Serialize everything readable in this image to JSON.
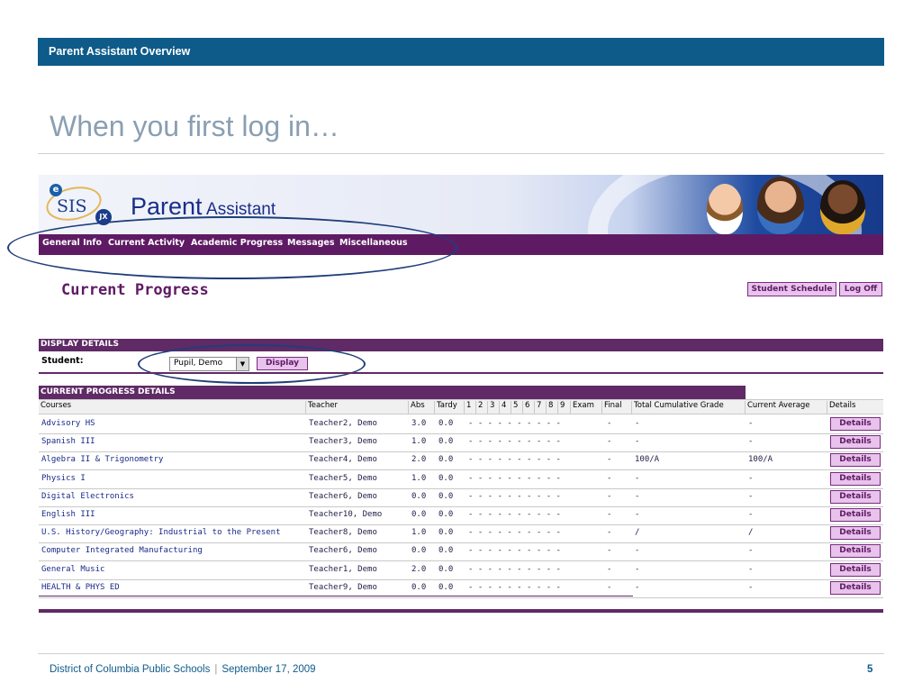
{
  "slide": {
    "header": "Parent Assistant Overview",
    "title": "When you first log in…",
    "footer_org": "District of Columbia Public Schools",
    "footer_separator": "|",
    "footer_date": "September 17, 2009",
    "page_number": "5"
  },
  "app": {
    "logo_e": "e",
    "logo_text": "SIS",
    "logo_badge": "JX",
    "title_main": "Parent",
    "title_sub": "Assistant",
    "nav": [
      "General Info",
      "Current Activity",
      "Academic Progress",
      "Messages",
      "Miscellaneous"
    ],
    "page_heading": "Current Progress",
    "student_schedule_label": "Student Schedule",
    "logoff_label": "Log Off",
    "display_details_label": "DISPLAY DETAILS",
    "student_label": "Student:",
    "student_value": "Pupil, Demo",
    "display_button": "Display",
    "progress_details_label": "CURRENT PROGRESS DETAILS"
  },
  "table": {
    "headers": [
      "Courses",
      "Teacher",
      "Abs",
      "Tardy",
      "1",
      "2",
      "3",
      "4",
      "5",
      "6",
      "7",
      "8",
      "9",
      "Exam",
      "Final",
      "Total Cumulative Grade",
      "Current Average",
      "Details"
    ],
    "rows": [
      {
        "course": "Advisory HS",
        "teacher": "Teacher2, Demo",
        "abs": "3.0",
        "tardy": "0.0",
        "periods": "- - - - - - - - - -",
        "final": "-",
        "total": "-",
        "avg": "-",
        "details": "Details"
      },
      {
        "course": "Spanish III",
        "teacher": "Teacher3, Demo",
        "abs": "1.0",
        "tardy": "0.0",
        "periods": "- - - - - - - - - -",
        "final": "-",
        "total": "-",
        "avg": "-",
        "details": "Details"
      },
      {
        "course": "Algebra II & Trigonometry",
        "teacher": "Teacher4, Demo",
        "abs": "2.0",
        "tardy": "0.0",
        "periods": "- - - - - - - - - -",
        "final": "-",
        "total": "100/A",
        "avg": "100/A",
        "details": "Details"
      },
      {
        "course": "Physics I",
        "teacher": "Teacher5, Demo",
        "abs": "1.0",
        "tardy": "0.0",
        "periods": "- - - - - - - - - -",
        "final": "-",
        "total": "-",
        "avg": "-",
        "details": "Details"
      },
      {
        "course": "Digital Electronics",
        "teacher": "Teacher6, Demo",
        "abs": "0.0",
        "tardy": "0.0",
        "periods": "- - - - - - - - - -",
        "final": "-",
        "total": "-",
        "avg": "-",
        "details": "Details"
      },
      {
        "course": "English III",
        "teacher": "Teacher10, Demo",
        "abs": "0.0",
        "tardy": "0.0",
        "periods": "- - - - - - - - - -",
        "final": "-",
        "total": "-",
        "avg": "-",
        "details": "Details"
      },
      {
        "course": "U.S. History/Geography: Industrial to the Present",
        "teacher": "Teacher8, Demo",
        "abs": "1.0",
        "tardy": "0.0",
        "periods": "- - - - - - - - - -",
        "final": "-",
        "total": "/",
        "avg": "/",
        "details": "Details"
      },
      {
        "course": "Computer Integrated Manufacturing",
        "teacher": "Teacher6, Demo",
        "abs": "0.0",
        "tardy": "0.0",
        "periods": "- - - - - - - - - -",
        "final": "-",
        "total": "-",
        "avg": "-",
        "details": "Details"
      },
      {
        "course": "General Music",
        "teacher": "Teacher1, Demo",
        "abs": "2.0",
        "tardy": "0.0",
        "periods": "- - - - - - - - - -",
        "final": "-",
        "total": "-",
        "avg": "-",
        "details": "Details"
      },
      {
        "course": "HEALTH & PHYS ED",
        "teacher": "Teacher9, Demo",
        "abs": "0.0",
        "tardy": "0.0",
        "periods": "- - - - - - - - - -",
        "final": "-",
        "total": "-",
        "avg": "-",
        "details": "Details"
      }
    ]
  },
  "colors": {
    "slide_blue": "#0e5b8a",
    "purple": "#5f1a64",
    "button_pink": "#e8c3ec",
    "annotation_navy": "#1f3e7a"
  }
}
